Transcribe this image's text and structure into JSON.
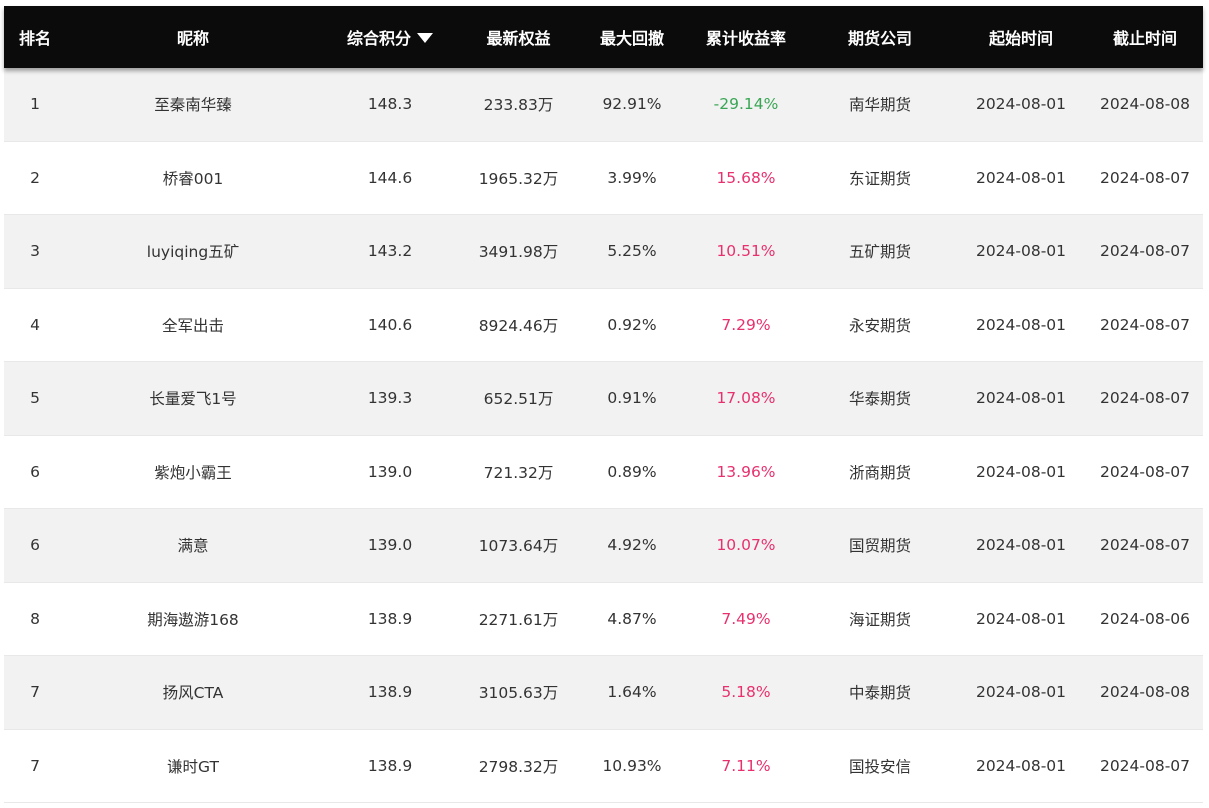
{
  "table": {
    "headers": {
      "rank": "排名",
      "name": "昵称",
      "score": "综合积分",
      "equity": "最新权益",
      "drawdown": "最大回撤",
      "return": "累计收益率",
      "company": "期货公司",
      "start": "起始时间",
      "end": "截止时间"
    },
    "sort_icon": "triangle-down-icon",
    "colors": {
      "header_bg": "#0b0b0b",
      "row_odd_bg": "#f2f2f2",
      "row_even_bg": "#ffffff",
      "positive_return": "#e8306e",
      "negative_return": "#3aa655"
    },
    "rows": [
      {
        "rank": "1",
        "name": "至秦南华臻",
        "score": "148.3",
        "equity": "233.83万",
        "drawdown": "92.91%",
        "return": "-29.14%",
        "company": "南华期货",
        "start": "2024-08-01",
        "end": "2024-08-08"
      },
      {
        "rank": "2",
        "name": "桥睿001",
        "score": "144.6",
        "equity": "1965.32万",
        "drawdown": "3.99%",
        "return": "15.68%",
        "company": "东证期货",
        "start": "2024-08-01",
        "end": "2024-08-07"
      },
      {
        "rank": "3",
        "name": "luyiqing五矿",
        "score": "143.2",
        "equity": "3491.98万",
        "drawdown": "5.25%",
        "return": "10.51%",
        "company": "五矿期货",
        "start": "2024-08-01",
        "end": "2024-08-07"
      },
      {
        "rank": "4",
        "name": "全军出击",
        "score": "140.6",
        "equity": "8924.46万",
        "drawdown": "0.92%",
        "return": "7.29%",
        "company": "永安期货",
        "start": "2024-08-01",
        "end": "2024-08-07"
      },
      {
        "rank": "5",
        "name": "长量爱飞1号",
        "score": "139.3",
        "equity": "652.51万",
        "drawdown": "0.91%",
        "return": "17.08%",
        "company": "华泰期货",
        "start": "2024-08-01",
        "end": "2024-08-07"
      },
      {
        "rank": "6",
        "name": "紫炮小霸王",
        "score": "139.0",
        "equity": "721.32万",
        "drawdown": "0.89%",
        "return": "13.96%",
        "company": "浙商期货",
        "start": "2024-08-01",
        "end": "2024-08-07"
      },
      {
        "rank": "6",
        "name": "满意",
        "score": "139.0",
        "equity": "1073.64万",
        "drawdown": "4.92%",
        "return": "10.07%",
        "company": "国贸期货",
        "start": "2024-08-01",
        "end": "2024-08-07"
      },
      {
        "rank": "8",
        "name": "期海遨游168",
        "score": "138.9",
        "equity": "2271.61万",
        "drawdown": "4.87%",
        "return": "7.49%",
        "company": "海证期货",
        "start": "2024-08-01",
        "end": "2024-08-06"
      },
      {
        "rank": "7",
        "name": "扬风CTA",
        "score": "138.9",
        "equity": "3105.63万",
        "drawdown": "1.64%",
        "return": "5.18%",
        "company": "中泰期货",
        "start": "2024-08-01",
        "end": "2024-08-08"
      },
      {
        "rank": "7",
        "name": "谦时GT",
        "score": "138.9",
        "equity": "2798.32万",
        "drawdown": "10.93%",
        "return": "7.11%",
        "company": "国投安信",
        "start": "2024-08-01",
        "end": "2024-08-07"
      }
    ]
  }
}
